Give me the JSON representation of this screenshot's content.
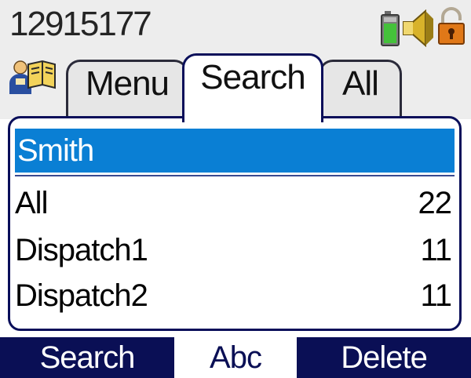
{
  "status_bar": {
    "number": "12915177",
    "icons": [
      "battery-icon",
      "speaker-icon",
      "lock-icon"
    ]
  },
  "tabs": {
    "icon": "contacts-book-icon",
    "items": [
      {
        "label": "Menu",
        "selected": false
      },
      {
        "label": "Search",
        "selected": true
      },
      {
        "label": "All",
        "selected": false
      }
    ]
  },
  "search": {
    "value": "Smith"
  },
  "list": {
    "rows": [
      {
        "label": "All",
        "count": "22"
      },
      {
        "label": "Dispatch1",
        "count": "11"
      },
      {
        "label": "Dispatch2",
        "count": "11"
      }
    ]
  },
  "softkeys": {
    "left": "Search",
    "center": "Abc",
    "right": "Delete"
  },
  "colors": {
    "navy": "#0a0f55",
    "highlight_blue": "#0a7fd4",
    "status_bg": "#ededed"
  }
}
